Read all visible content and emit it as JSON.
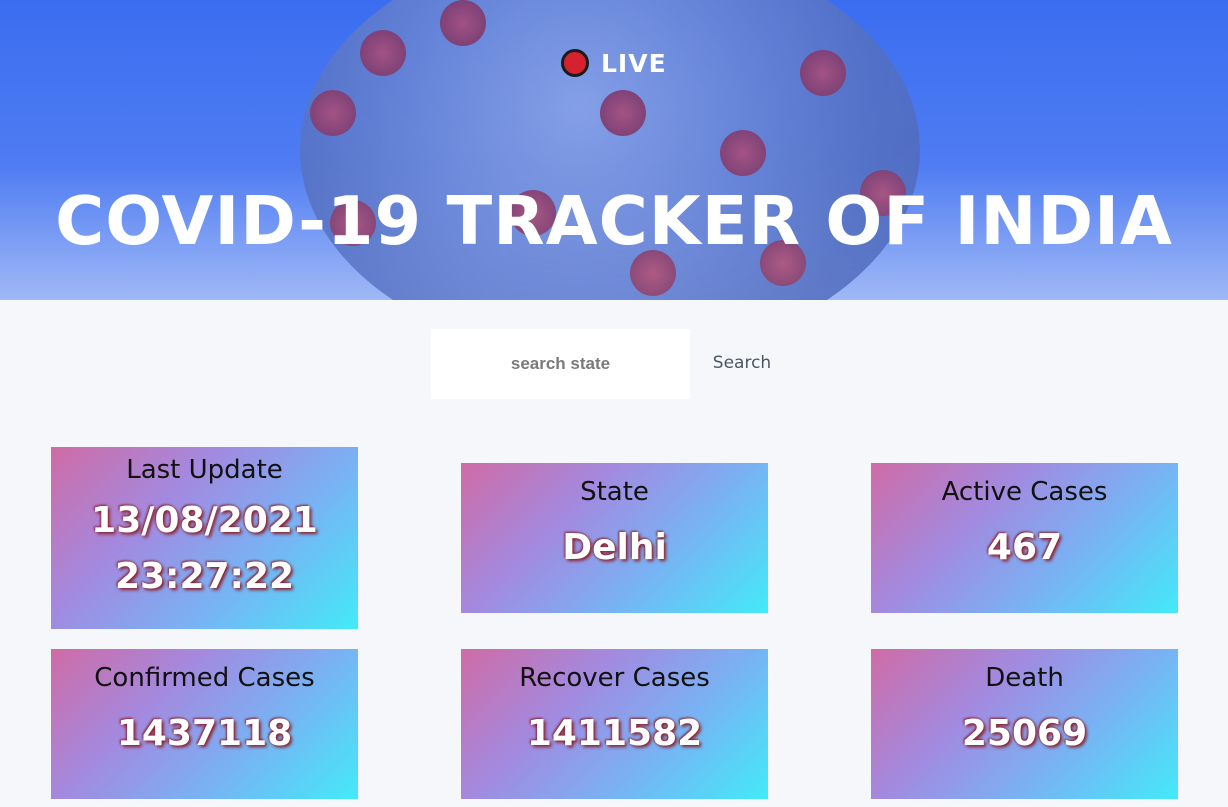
{
  "header": {
    "live_label": "LIVE",
    "title": "COVID-19 TRACKER OF INDIA"
  },
  "search": {
    "placeholder": "search state",
    "button_label": "Search"
  },
  "cards": {
    "last_update": {
      "label": "Last Update",
      "date": "13/08/2021",
      "time": "23:27:22"
    },
    "state": {
      "label": "State",
      "value": "Delhi"
    },
    "active": {
      "label": "Active Cases",
      "value": "467"
    },
    "confirmed": {
      "label": "Confirmed Cases",
      "value": "1437118"
    },
    "recovered": {
      "label": "Recover Cases",
      "value": "1411582"
    },
    "death": {
      "label": "Death",
      "value": "25069"
    }
  },
  "colors": {
    "hero_blue": "#3a6df0",
    "live_dot": "#d6222e",
    "card_gradient_start": "#d06ba6",
    "card_gradient_end": "#43eaf8"
  }
}
